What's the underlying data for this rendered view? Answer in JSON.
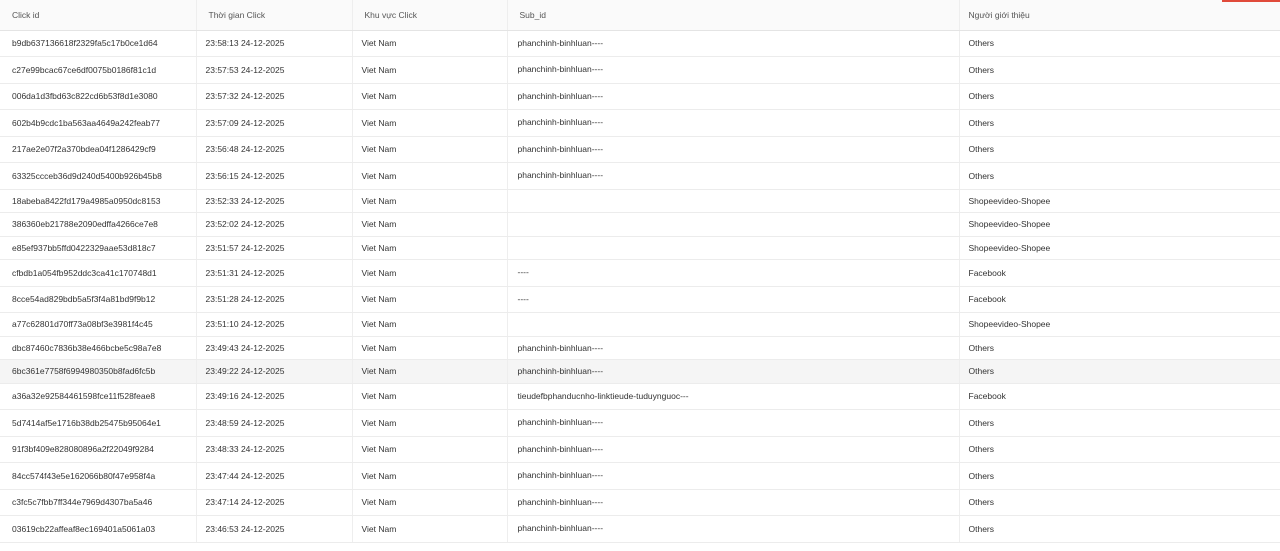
{
  "table": {
    "columns": {
      "click_id": "Click id",
      "click_time": "Thời gian Click",
      "region": "Khu vực Click",
      "sub_id": "Sub_id",
      "referrer": "Người giới thiệu"
    },
    "rows": [
      {
        "click_id": "b9db637136618f2329fa5c17b0ce1d64",
        "click_time": "23:58:13 24-12-2025",
        "region": "Viet Nam",
        "sub_id": "phanchinh-binhluan----",
        "referrer": "Others"
      },
      {
        "click_id": "c27e99bcac67ce6df0075b0186f81c1d",
        "click_time": "23:57:53 24-12-2025",
        "region": "Viet Nam",
        "sub_id": "phanchinh-binhluan----",
        "referrer": "Others"
      },
      {
        "click_id": "006da1d3fbd63c822cd6b53f8d1e3080",
        "click_time": "23:57:32 24-12-2025",
        "region": "Viet Nam",
        "sub_id": "phanchinh-binhluan----",
        "referrer": "Others"
      },
      {
        "click_id": "602b4b9cdc1ba563aa4649a242feab77",
        "click_time": "23:57:09 24-12-2025",
        "region": "Viet Nam",
        "sub_id": "phanchinh-binhluan----",
        "referrer": "Others"
      },
      {
        "click_id": "217ae2e07f2a370bdea04f1286429cf9",
        "click_time": "23:56:48 24-12-2025",
        "region": "Viet Nam",
        "sub_id": "phanchinh-binhluan----",
        "referrer": "Others"
      },
      {
        "click_id": "63325ccceb36d9d240d5400b926b45b8",
        "click_time": "23:56:15 24-12-2025",
        "region": "Viet Nam",
        "sub_id": "phanchinh-binhluan----",
        "referrer": "Others"
      },
      {
        "click_id": "18abeba8422fd179a4985a0950dc8153",
        "click_time": "23:52:33 24-12-2025",
        "region": "Viet Nam",
        "sub_id": "",
        "referrer": "Shopeevideo-Shopee"
      },
      {
        "click_id": "386360eb21788e2090edffa4266ce7e8",
        "click_time": "23:52:02 24-12-2025",
        "region": "Viet Nam",
        "sub_id": "",
        "referrer": "Shopeevideo-Shopee"
      },
      {
        "click_id": "e85ef937bb5ffd0422329aae53d818c7",
        "click_time": "23:51:57 24-12-2025",
        "region": "Viet Nam",
        "sub_id": "",
        "referrer": "Shopeevideo-Shopee"
      },
      {
        "click_id": "cfbdb1a054fb952ddc3ca41c170748d1",
        "click_time": "23:51:31 24-12-2025",
        "region": "Viet Nam",
        "sub_id": "----",
        "referrer": "Facebook"
      },
      {
        "click_id": "8cce54ad829bdb5a5f3f4a81bd9f9b12",
        "click_time": "23:51:28 24-12-2025",
        "region": "Viet Nam",
        "sub_id": "----",
        "referrer": "Facebook"
      },
      {
        "click_id": "a77c62801d70ff73a08bf3e3981f4c45",
        "click_time": "23:51:10 24-12-2025",
        "region": "Viet Nam",
        "sub_id": "",
        "referrer": "Shopeevideo-Shopee"
      },
      {
        "click_id": "dbc87460c7836b38e466bcbe5c98a7e8",
        "click_time": "23:49:43 24-12-2025",
        "region": "Viet Nam",
        "sub_id": "phanchinh-binhluan----",
        "referrer": "Others"
      },
      {
        "click_id": "6bc361e7758f6994980350b8fad6fc5b",
        "click_time": "23:49:22 24-12-2025",
        "region": "Viet Nam",
        "sub_id": "phanchinh-binhluan----",
        "referrer": "Others"
      },
      {
        "click_id": "a36a32e92584461598fce11f528feae8",
        "click_time": "23:49:16 24-12-2025",
        "region": "Viet Nam",
        "sub_id": "tieudefbphanducnho-linktieude-tuduynguoc---",
        "referrer": "Facebook"
      },
      {
        "click_id": "5d7414af5e1716b38db25475b95064e1",
        "click_time": "23:48:59 24-12-2025",
        "region": "Viet Nam",
        "sub_id": "phanchinh-binhluan----",
        "referrer": "Others"
      },
      {
        "click_id": "91f3bf409e828080896a2f22049f9284",
        "click_time": "23:48:33 24-12-2025",
        "region": "Viet Nam",
        "sub_id": "phanchinh-binhluan----",
        "referrer": "Others"
      },
      {
        "click_id": "84cc574f43e5e162066b80f47e958f4a",
        "click_time": "23:47:44 24-12-2025",
        "region": "Viet Nam",
        "sub_id": "phanchinh-binhluan----",
        "referrer": "Others"
      },
      {
        "click_id": "c3fc5c7fbb7ff344e7969d4307ba5a46",
        "click_time": "23:47:14 24-12-2025",
        "region": "Viet Nam",
        "sub_id": "phanchinh-binhluan----",
        "referrer": "Others"
      },
      {
        "click_id": "03619cb22affeaf8ec169401a5061a03",
        "click_time": "23:46:53 24-12-2025",
        "region": "Viet Nam",
        "sub_id": "phanchinh-binhluan----",
        "referrer": "Others"
      }
    ]
  }
}
